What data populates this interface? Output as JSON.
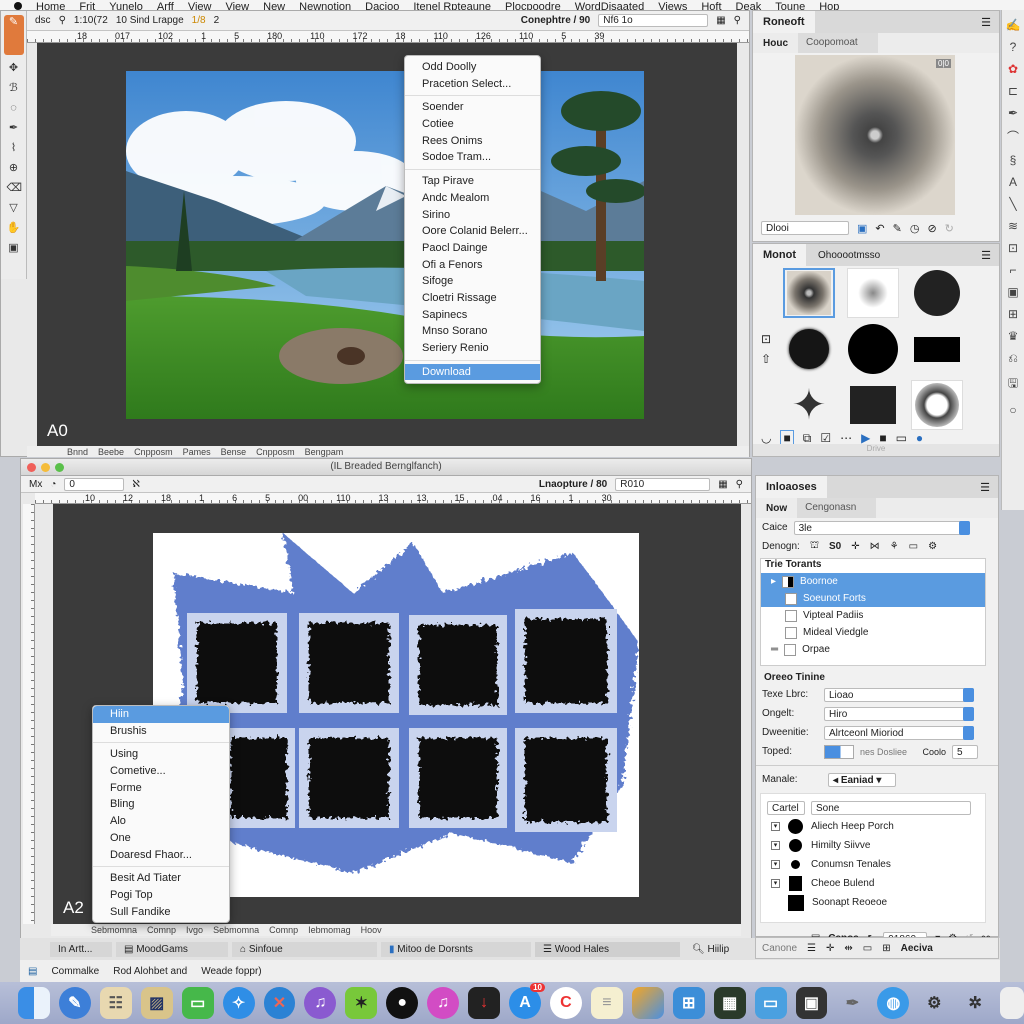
{
  "menubar": {
    "items": [
      "Home",
      "Frit",
      "Yunelo",
      "Arff",
      "View",
      "View",
      "New",
      "Newnotion",
      "Dacioo",
      "Itenel Rpteaune",
      "Plocpoodre",
      "WordDisaated",
      "Views",
      "Hoft",
      "Deak",
      "Toune",
      "Hop"
    ]
  },
  "window1": {
    "options": {
      "a": "dsc",
      "b": "10 Sind Lrapge",
      "c": "1:10(72",
      "d": "1/8",
      "e": "2",
      "zoom_label": "Conephtre / 90",
      "zoom_value": "Nf6 1o"
    },
    "ruler": [
      "18",
      "017",
      "102",
      "1",
      "5",
      "180",
      "110",
      "172",
      "18",
      "110",
      "126",
      "110",
      "5",
      "39"
    ],
    "canvas_label": "A0",
    "doc_tabs": [
      "Bnnd",
      "Beebe",
      "Cnpposm",
      "Pames",
      "Bense",
      "Cnpposm",
      "Bengpam"
    ],
    "context_menu": {
      "items": [
        [
          "Odd Doolly",
          "Pracetion Select..."
        ],
        [
          "Soender",
          "Cotiee",
          "Rees Onims",
          "Sodoe Tram..."
        ],
        [
          "Tap Ріrave",
          "Andc Mealom",
          "Sirino",
          "Oore Colanid Belerr...",
          "Paocl Dainge",
          "Ofi a Fenors",
          "Sifoge",
          "Cloetri Rissage",
          "Sapinecs",
          "Mnso Sorano",
          "Seriery Renio"
        ],
        [
          "Download"
        ]
      ],
      "highlighted": "Download"
    }
  },
  "panel1": {
    "title": "Roneoft",
    "sub_tab1": "Houc",
    "sub_tab2": "Coopomoat",
    "preview_badge": "0|0",
    "preset_field": "Dlooi"
  },
  "panel2": {
    "title": "Monot",
    "tab2": "Ohooootmsso",
    "footer": "Drive"
  },
  "window2": {
    "title": "(IL Breaded Bernglfanch)",
    "options": {
      "a": "Mx",
      "b": "0",
      "zoom_label": "Lnaopture / 80",
      "zoom_value": "R010"
    },
    "ruler": [
      "10",
      "12",
      "18",
      "1",
      "6",
      "5",
      "00",
      "110",
      "13",
      "13",
      "15",
      "04",
      "16",
      "1",
      "30"
    ],
    "canvas_label": "A2",
    "doc_tabs": [
      "Sebmomna",
      "Comnp",
      "Ivgo",
      "Sebmomna",
      "Comnp",
      "Iebmomag",
      "Hoov"
    ],
    "context_menu": {
      "items": [
        [
          "Hiin",
          "Brushis"
        ],
        [
          "Using",
          "Cometive...",
          "Forme",
          "Bling",
          "Alo",
          "One",
          "Doaresd Fhaor..."
        ],
        [
          "Besit Ad Tiater",
          "Pogi Top",
          "Sull Fandike"
        ]
      ],
      "highlighted": "Hiin"
    },
    "bottom_tabs": [
      "In Artt...",
      "MoodGams",
      "Sinfoue",
      "Mitoo de Dorsnts",
      "Wood Hales",
      "Hiilip"
    ],
    "status": [
      "Commalke",
      "Rod Alohbet and",
      "Weade foppr)"
    ]
  },
  "panel3": {
    "title": "Inloaoses",
    "sub_tab1": "Now",
    "sub_tab2": "Cengonasn",
    "color_label": "Caice",
    "color_value": "3le",
    "design_label": "Denogn:",
    "design_value": "S0",
    "section1": "Trie Torants",
    "tree": [
      {
        "label": "Boornoe",
        "selected": true
      },
      {
        "label": "Soeunot Forts",
        "selected": true
      },
      {
        "label": "Vipteal Padiis",
        "selected": false
      },
      {
        "label": "Mideal Viedgle",
        "selected": false
      },
      {
        "label": "Orpae",
        "selected": false
      }
    ],
    "section2": "Oreeo Tinine",
    "fields": [
      {
        "label": "Texe Lbrc:",
        "value": "Lioao"
      },
      {
        "label": "Ongelt:",
        "value": "Hiro"
      },
      {
        "label": "Dweenitie:",
        "value": "Alrtceonl Mioriod"
      }
    ],
    "toped_label": "Toped:",
    "toped_text": "nes Dosliee",
    "cools_label": "Coolo",
    "cools_value": "5",
    "manale_label": "Manale:",
    "manale_value": "Eaniad",
    "cartel_label": "Cartel",
    "cartel_value": "Sone",
    "brush_list": [
      "Aliech Heep Porch",
      "Himilty Siivve",
      "Conumsn Tenales",
      "Cheoe Bulend",
      "Soonapt Reoeoe"
    ],
    "footer_label": "Canoa",
    "footer_value": "91860",
    "footer2_label": "Canone",
    "footer2_action": "Aeciva"
  },
  "dock": {
    "badge": "10",
    "accent": "#5a9be0"
  }
}
